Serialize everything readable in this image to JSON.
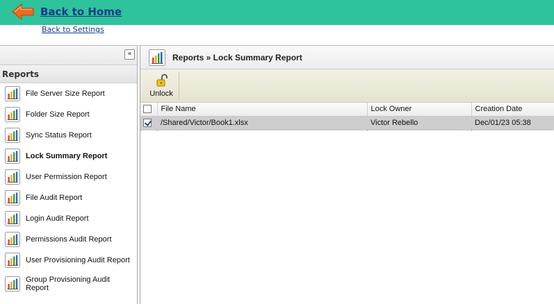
{
  "header": {
    "back_home": "Back to Home",
    "back_settings": "Back to Settings"
  },
  "sidebar": {
    "collapse_glyph": "«",
    "title": "Reports",
    "items": [
      {
        "label": "File Server Size Report"
      },
      {
        "label": "Folder Size Report"
      },
      {
        "label": "Sync Status Report"
      },
      {
        "label": "Lock Summary Report"
      },
      {
        "label": "User Permission Report"
      },
      {
        "label": "File Audit Report"
      },
      {
        "label": "Login Audit Report"
      },
      {
        "label": "Permissions Audit Report"
      },
      {
        "label": "User Provisioning Audit Report"
      },
      {
        "label": "Group Provisioning Audit Report"
      }
    ],
    "active_index": 3
  },
  "main": {
    "breadcrumb": "Reports » Lock Summary Report",
    "toolbar": {
      "unlock_label": "Unlock"
    },
    "table": {
      "columns": [
        "File Name",
        "Lock Owner",
        "Creation Date"
      ],
      "rows": [
        {
          "file_name": "/Shared/Victor/Book1.xlsx",
          "lock_owner": "Victor Rebello",
          "creation_date": "Dec/01/23 05:38",
          "checked": true
        }
      ]
    }
  },
  "colors": {
    "header_bg": "#2ec39b",
    "link": "#173a8c",
    "arrow": "#ef6a1d",
    "selected_row": "#cdcdcd"
  },
  "icons": {
    "back": "back-arrow-icon",
    "report": "bar-chart-icon",
    "unlock": "padlock-open-icon"
  }
}
